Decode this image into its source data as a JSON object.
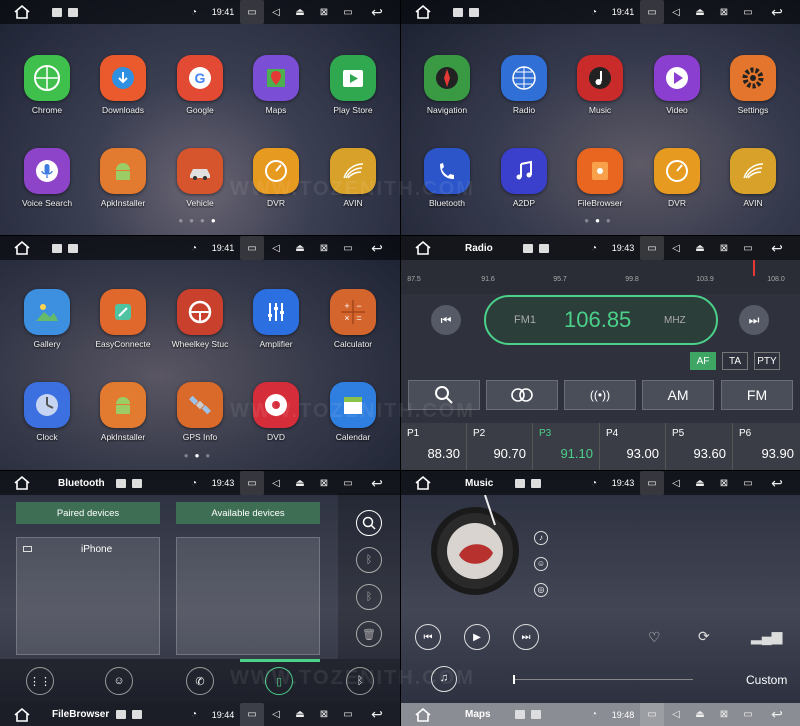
{
  "statusbar": {
    "home_icon": "home-icon"
  },
  "panels": {
    "home1": {
      "time": "19:41",
      "apps": [
        "Chrome",
        "Downloads",
        "Google",
        "Maps",
        "Play Store",
        "Voice Search",
        "ApkInstaller",
        "Vehicle",
        "DVR",
        "AVIN"
      ]
    },
    "home2": {
      "time": "19:41",
      "apps": [
        "Navigation",
        "Radio",
        "Music",
        "Video",
        "Settings",
        "Bluetooth",
        "A2DP",
        "FileBrowser",
        "DVR",
        "AVIN"
      ]
    },
    "home3": {
      "time": "19:41",
      "apps": [
        "Gallery",
        "EasyConnecte",
        "Wheelkey Stuc",
        "Amplifier",
        "Calculator",
        "Clock",
        "ApkInstaller",
        "GPS Info",
        "DVD",
        "Calendar"
      ]
    },
    "radio": {
      "title": "Radio",
      "time": "19:43",
      "scale": [
        "87.5",
        "91.6",
        "95.7",
        "99.8",
        "103.9",
        "108.0"
      ],
      "band": "FM1",
      "frequency": "106.85",
      "unit": "MHZ",
      "tags": [
        "AF",
        "TA",
        "PTY"
      ],
      "buttons": [
        "AM",
        "FM"
      ],
      "presets": [
        {
          "name": "P1",
          "value": "88.30"
        },
        {
          "name": "P2",
          "value": "90.70"
        },
        {
          "name": "P3",
          "value": "91.10"
        },
        {
          "name": "P4",
          "value": "93.00"
        },
        {
          "name": "P5",
          "value": "93.60"
        },
        {
          "name": "P6",
          "value": "93.90"
        }
      ]
    },
    "bluetooth": {
      "title": "Bluetooth",
      "time": "19:43",
      "paired_header": "Paired devices",
      "available_header": "Available devices",
      "paired_device": "iPhone"
    },
    "music": {
      "title": "Music",
      "time": "19:43",
      "mode": "Custom"
    },
    "filebrowser": {
      "title": "FileBrowser",
      "time": "19:44"
    },
    "maps": {
      "title": "Maps",
      "time": "19:48"
    }
  },
  "watermark": "WWW.TOZENITH.COM",
  "colors": {
    "accent_green": "#4bd08a",
    "bt_header": "#3e6f55"
  }
}
